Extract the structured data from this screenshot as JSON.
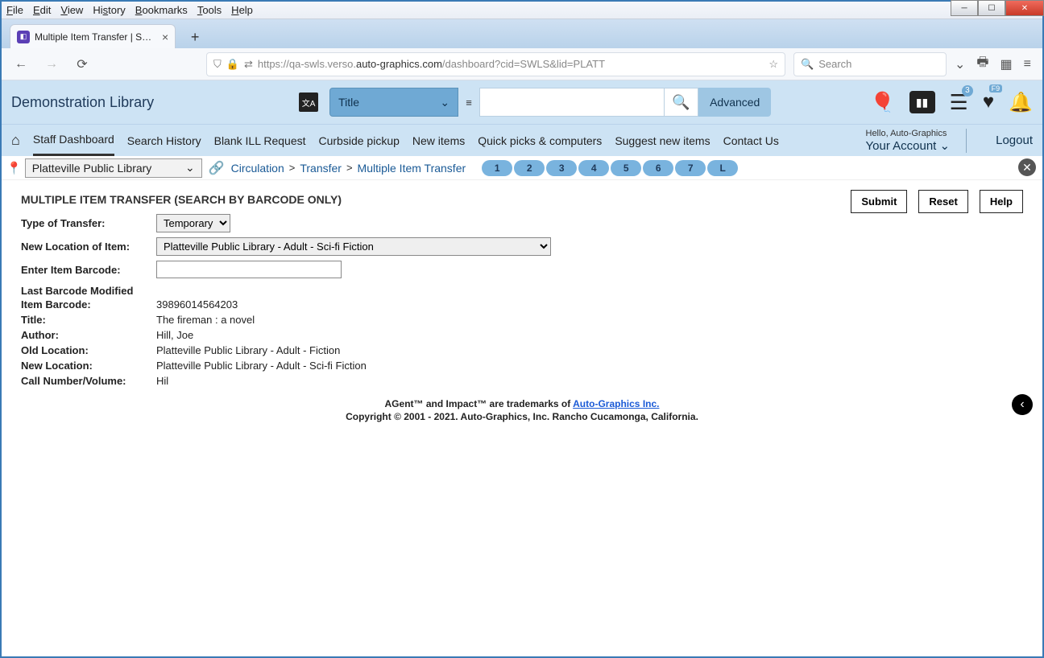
{
  "browser": {
    "menus": [
      "File",
      "Edit",
      "View",
      "History",
      "Bookmarks",
      "Tools",
      "Help"
    ],
    "tab_title": "Multiple Item Transfer | SWLS | p",
    "url_prefix": "https://qa-swls.verso.",
    "url_bold": "auto-graphics.com",
    "url_suffix": "/dashboard?cid=SWLS&lid=PLATT",
    "search_placeholder": "Search"
  },
  "header": {
    "library_name": "Demonstration Library",
    "search_type": "Title",
    "advanced": "Advanced",
    "card_badge": "3",
    "heart_badge": "F9"
  },
  "nav": {
    "items": [
      "Staff Dashboard",
      "Search History",
      "Blank ILL Request",
      "Curbside pickup",
      "New items",
      "Quick picks & computers",
      "Suggest new items",
      "Contact Us"
    ],
    "hello": "Hello, Auto-Graphics",
    "account": "Your Account",
    "logout": "Logout"
  },
  "crumbs": {
    "location": "Platteville Public Library",
    "c1": "Circulation",
    "c2": "Transfer",
    "c3": "Multiple Item Transfer",
    "steps": [
      "1",
      "2",
      "3",
      "4",
      "5",
      "6",
      "7",
      "L"
    ]
  },
  "page": {
    "title": "MULTIPLE ITEM TRANSFER (SEARCH BY BARCODE ONLY)",
    "submit": "Submit",
    "reset": "Reset",
    "help": "Help",
    "labels": {
      "type": "Type of Transfer:",
      "newloc": "New Location of Item:",
      "barcode": "Enter Item Barcode:",
      "lastmod": "Last Barcode Modified",
      "item_barcode": "Item Barcode:",
      "title": "Title:",
      "author": "Author:",
      "oldloc": "Old Location:",
      "newloc2": "New Location:",
      "callno": "Call Number/Volume:"
    },
    "values": {
      "type": "Temporary",
      "newloc": "Platteville Public Library - Adult - Sci-fi Fiction",
      "barcode": "",
      "item_barcode": "39896014564203",
      "title": "The fireman : a novel",
      "author": "Hill, Joe",
      "oldloc": "Platteville Public Library - Adult - Fiction",
      "newloc2": "Platteville Public Library - Adult - Sci-fi Fiction",
      "callno": "Hil"
    }
  },
  "footer": {
    "l1a": "AGent™ and Impact™ are trademarks of ",
    "l1link": "Auto-Graphics Inc.",
    "l2": "Copyright © 2001 - 2021. Auto-Graphics, Inc. Rancho Cucamonga, California."
  }
}
